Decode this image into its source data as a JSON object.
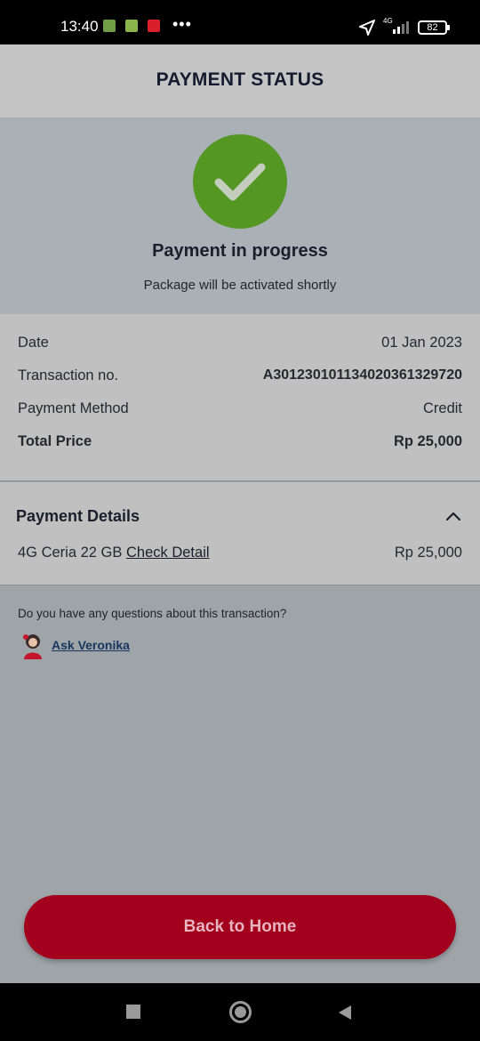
{
  "status_bar": {
    "time": "13:40",
    "app_icons": [
      "calculator-app-icon",
      "shop-app-icon",
      "shield-app-icon"
    ],
    "more": "•••",
    "network": "4G",
    "battery": "82"
  },
  "header": {
    "title": "PAYMENT STATUS"
  },
  "hero": {
    "icon": "check-icon",
    "status_title": "Payment in progress",
    "status_subtitle": "Package will be activated shortly",
    "check_color": "#549722"
  },
  "summary": {
    "rows": [
      {
        "label": "Date",
        "value": "01 Jan 2023"
      },
      {
        "label": "Transaction no.",
        "value": "A301230101134020361329720"
      },
      {
        "label": "Payment Method",
        "value": "Credit"
      },
      {
        "label": "Total Price",
        "value": "Rp 25,000"
      }
    ]
  },
  "details": {
    "title": "Payment Details",
    "item_name": "4G Ceria 22 GB",
    "item_link": "Check Detail",
    "item_price": "Rp 25,000"
  },
  "help": {
    "question": "Do you have any questions about this transaction?",
    "ask_label": "Ask Veronika"
  },
  "footer": {
    "button_label": "Back to Home",
    "button_color": "#a2001d"
  }
}
